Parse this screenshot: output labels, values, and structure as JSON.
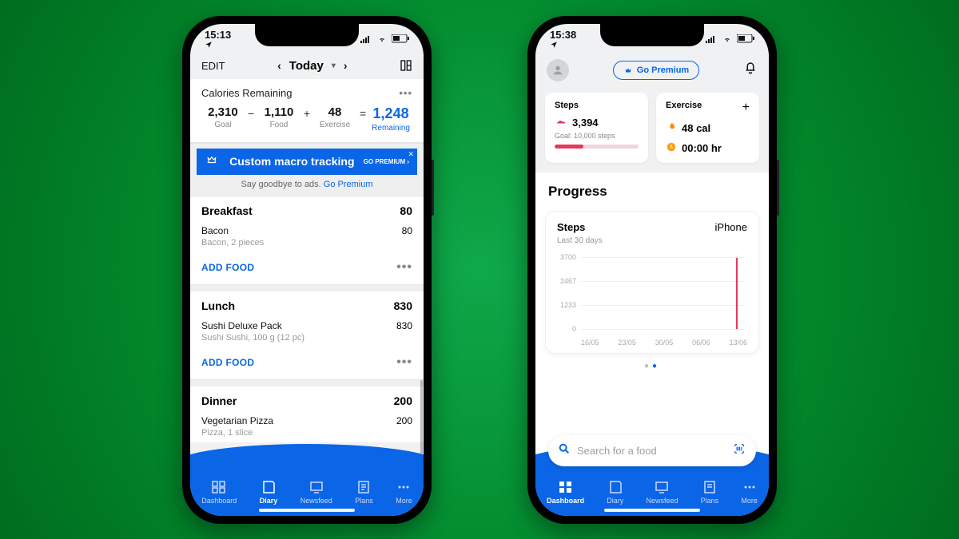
{
  "phone1": {
    "status": {
      "time": "15:13"
    },
    "toolbar": {
      "edit": "EDIT",
      "date_label": "Today"
    },
    "remaining": {
      "heading": "Calories Remaining",
      "goal": {
        "val": "2,310",
        "lab": "Goal"
      },
      "food": {
        "val": "1,110",
        "lab": "Food"
      },
      "exercise": {
        "val": "48",
        "lab": "Exercise"
      },
      "remain": {
        "val": "1,248",
        "lab": "Remaining"
      }
    },
    "promo": {
      "text": "Custom macro tracking",
      "cta": "GO PREMIUM ›"
    },
    "subpromo": {
      "text": "Say goodbye to ads. ",
      "link": "Go Premium"
    },
    "meals": [
      {
        "name": "Breakfast",
        "total": "80",
        "items": [
          {
            "name": "Bacon",
            "desc": "Bacon, 2 pieces",
            "cal": "80"
          }
        ]
      },
      {
        "name": "Lunch",
        "total": "830",
        "items": [
          {
            "name": "Sushi Deluxe Pack",
            "desc": "Sushi Sushi, 100 g (12 pc)",
            "cal": "830"
          }
        ]
      },
      {
        "name": "Dinner",
        "total": "200",
        "items": [
          {
            "name": "Vegetarian Pizza",
            "desc": "Pizza, 1 slice",
            "cal": "200"
          }
        ]
      }
    ],
    "add_food": "ADD FOOD",
    "tabs": [
      "Dashboard",
      "Diary",
      "Newsfeed",
      "Plans",
      "More"
    ],
    "active_tab": 1
  },
  "phone2": {
    "status": {
      "time": "15:38"
    },
    "header": {
      "go_premium": "Go Premium"
    },
    "steps_card": {
      "title": "Steps",
      "value": "3,394",
      "goal": "Goal: 10,000 steps",
      "progress_pct": 34
    },
    "exercise_card": {
      "title": "Exercise",
      "cal": "48 cal",
      "time": "00:00 hr"
    },
    "progress_heading": "Progress",
    "chart": {
      "title": "Steps",
      "subtitle": "Last 30 days",
      "device": "iPhone"
    },
    "search_placeholder": "Search for a food",
    "tabs": [
      "Dashboard",
      "Diary",
      "Newsfeed",
      "Plans",
      "More"
    ],
    "active_tab": 0
  },
  "chart_data": {
    "type": "line",
    "title": "Steps",
    "subtitle": "Last 30 days",
    "xlabel": "",
    "ylabel": "",
    "ylim": [
      0,
      3700
    ],
    "y_ticks": [
      0,
      1233,
      2467,
      3700
    ],
    "x_ticks": [
      "16/05",
      "23/05",
      "30/05",
      "06/06",
      "13/06"
    ],
    "series": [
      {
        "name": "Steps",
        "x": [
          "16/05",
          "23/05",
          "30/05",
          "06/06",
          "13/06"
        ],
        "values": [
          0,
          0,
          0,
          0,
          3700
        ]
      }
    ]
  }
}
